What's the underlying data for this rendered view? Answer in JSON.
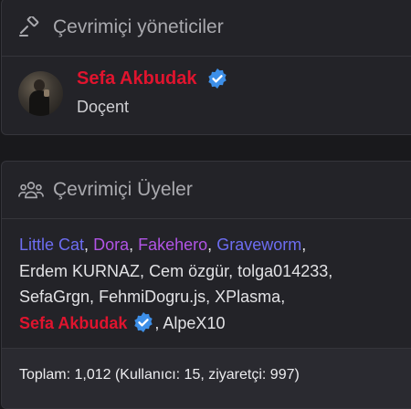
{
  "admins_card": {
    "title": "Çevrimiçi yöneticiler",
    "icon": "gavel-icon",
    "admin": {
      "name": "Sefa Akbudak",
      "role": "Doçent",
      "verified": true,
      "name_color": "#e0142e"
    }
  },
  "members_card": {
    "title": "Çevrimiçi Üyeler",
    "icon": "users-icon",
    "members": [
      {
        "name": "Little Cat",
        "color": "#6d6df2"
      },
      {
        "name": "Dora",
        "color": "#b154e6"
      },
      {
        "name": "Fakehero",
        "color": "#b154e6"
      },
      {
        "name": "Graveworm",
        "color": "#6d6df2"
      },
      {
        "name": "Erdem KURNAZ",
        "color": "#e2e2e5"
      },
      {
        "name": "Cem özgür",
        "color": "#e2e2e5"
      },
      {
        "name": "tolga014233",
        "color": "#e2e2e5"
      },
      {
        "name": "SefaGrgn",
        "color": "#e2e2e5"
      },
      {
        "name": "FehmiDogru.js",
        "color": "#e2e2e5"
      },
      {
        "name": "XPlasma",
        "color": "#e2e2e5"
      },
      {
        "name": "Sefa Akbudak",
        "color": "#e0142e",
        "verified": true
      },
      {
        "name": "AlpeX10",
        "color": "#e2e2e5"
      }
    ],
    "footer": "Toplam: 1,012 (Kullanıcı: 15, ziyaretçi: 997)"
  }
}
